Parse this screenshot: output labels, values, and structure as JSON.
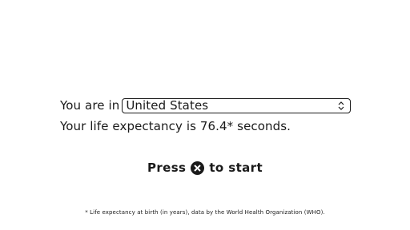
{
  "country": {
    "prefix": "You are in",
    "selected": "United States"
  },
  "expectancy": {
    "prefix": "Your life expectancy is",
    "value": "76.4*",
    "unit": "seconds."
  },
  "start": {
    "press_label": "Press",
    "button_icon": "cross-button-icon",
    "suffix_label": "to start"
  },
  "footnote": "* Life expectancy at birth (in years), data by the World Health Organization (WHO)."
}
